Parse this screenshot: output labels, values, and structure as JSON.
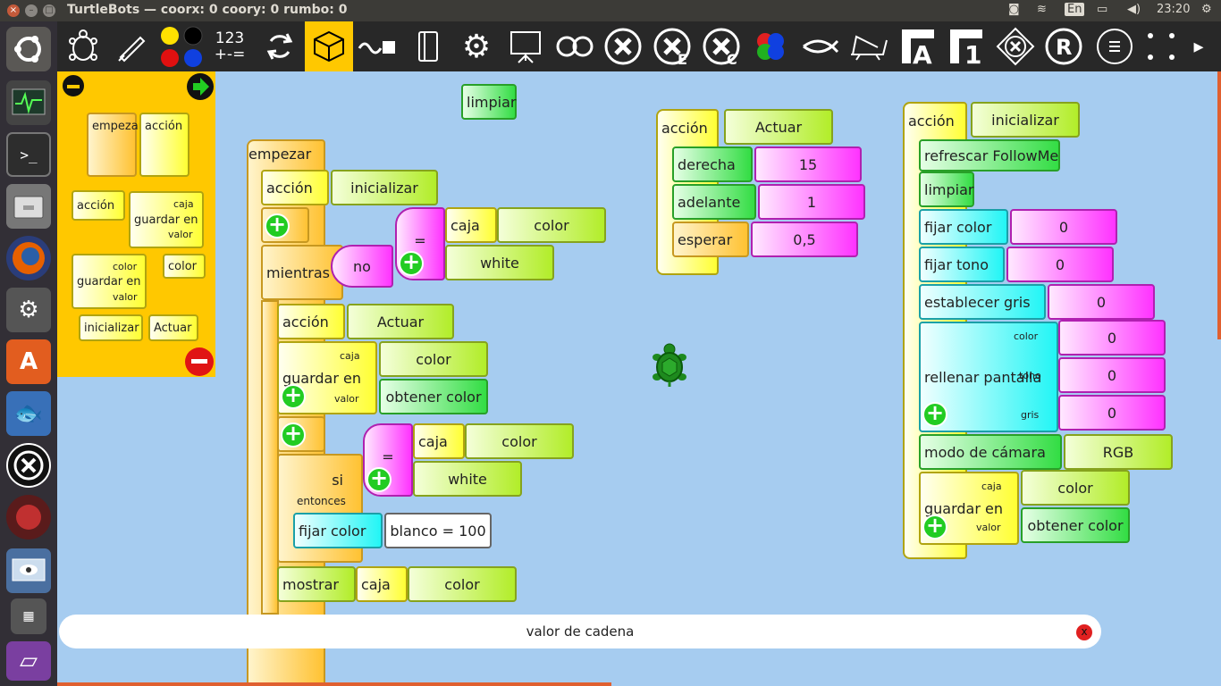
{
  "window": {
    "title": "TurtleBots — coorx: 0 coory: 0 rumbo: 0"
  },
  "indicators": {
    "lang": "En",
    "time": "23:20"
  },
  "toolbar": {
    "number_top": "123",
    "number_bottom": "+-="
  },
  "palette": {
    "empezar": "empezar",
    "accion": "acción",
    "accion2": "acción",
    "guardar_en": "guardar en",
    "caja": "caja",
    "valor": "valor",
    "color_label": "color",
    "color": "color",
    "inicializar": "inicializar",
    "actuar": "Actuar"
  },
  "canvas": {
    "limpiar": "limpiar",
    "stack1": {
      "empezar": "empezar",
      "accion": "acción",
      "accion_arg": "inicializar",
      "mientras": "mientras",
      "no": "no",
      "eq": "=",
      "caja": "caja",
      "caja_arg": "color",
      "white": "white",
      "accion2": "acción",
      "accion2_arg": "Actuar",
      "guardar_en": "guardar en",
      "caja_lbl": "caja",
      "valor_lbl": "valor",
      "guardar_caja": "color",
      "guardar_valor": "obtener color",
      "eq2": "=",
      "caja2": "caja",
      "caja2_arg": "color",
      "white2": "white",
      "si": "si",
      "entonces": "entonces",
      "fijar_color": "fijar color",
      "fijar_color_arg": "blanco = 100",
      "mostrar": "mostrar",
      "mostrar_caja": "caja",
      "mostrar_caja_arg": "color"
    },
    "stack2": {
      "accion": "acción",
      "accion_arg": "Actuar",
      "derecha": "derecha",
      "derecha_val": "15",
      "adelante": "adelante",
      "adelante_val": "1",
      "esperar": "esperar",
      "esperar_val": "0,5"
    },
    "stack3": {
      "accion": "acción",
      "accion_arg": "inicializar",
      "refrescar": "refrescar FollowMe",
      "limpiar": "limpiar",
      "fijar_color": "fijar color",
      "fijar_color_val": "0",
      "fijar_tono": "fijar tono",
      "fijar_tono_val": "0",
      "establecer_gris": "establecer gris",
      "establecer_gris_val": "0",
      "rellenar": "rellenar pantalla",
      "color_lbl": "color",
      "tono_lbl": "tono",
      "gris_lbl": "gris",
      "rellenar_color": "0",
      "rellenar_tono": "0",
      "rellenar_gris": "0",
      "modo_camara": "modo de cámara",
      "modo_camara_val": "RGB",
      "guardar_en": "guardar en",
      "caja_lbl": "caja",
      "valor_lbl": "valor",
      "guardar_caja": "color",
      "guardar_valor": "obtener color"
    }
  },
  "status": {
    "text": "valor de cadena",
    "close": "x"
  }
}
